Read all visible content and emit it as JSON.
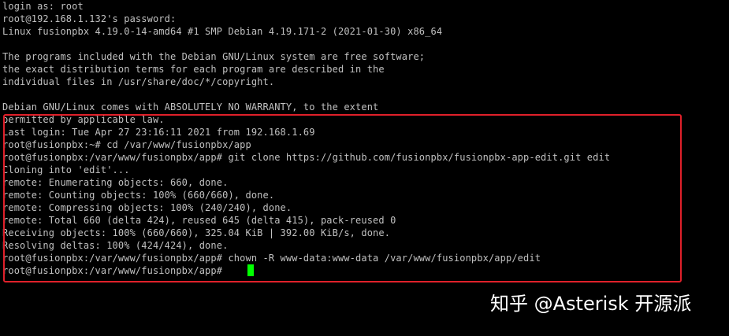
{
  "terminal": {
    "lines": [
      "login as: root",
      "root@192.168.1.132's password:",
      "Linux fusionpbx 4.19.0-14-amd64 #1 SMP Debian 4.19.171-2 (2021-01-30) x86_64",
      "",
      "The programs included with the Debian GNU/Linux system are free software;",
      "the exact distribution terms for each program are described in the",
      "individual files in /usr/share/doc/*/copyright.",
      "",
      "Debian GNU/Linux comes with ABSOLUTELY NO WARRANTY, to the extent",
      "permitted by applicable law.",
      "Last login: Tue Apr 27 23:16:11 2021 from 192.168.1.69",
      "root@fusionpbx:~# cd /var/www/fusionpbx/app",
      "root@fusionpbx:/var/www/fusionpbx/app# git clone https://github.com/fusionpbx/fusionpbx-app-edit.git edit",
      "Cloning into 'edit'...",
      "remote: Enumerating objects: 660, done.",
      "remote: Counting objects: 100% (660/660), done.",
      "remote: Compressing objects: 100% (240/240), done.",
      "remote: Total 660 (delta 424), reused 645 (delta 415), pack-reused 0",
      "Receiving objects: 100% (660/660), 325.04 KiB | 392.00 KiB/s, done.",
      "Resolving deltas: 100% (424/424), done.",
      "root@fusionpbx:/var/www/fusionpbx/app# chown -R www-data:www-data /var/www/fusionpbx/app/edit",
      "root@fusionpbx:/var/www/fusionpbx/app# "
    ]
  },
  "watermark": "知乎 @Asterisk 开源派",
  "colors": {
    "background": "#000000",
    "text": "#c0c0c0",
    "cursor": "#00ff00",
    "highlight": "#e0202a",
    "watermark": "#ffffff"
  }
}
